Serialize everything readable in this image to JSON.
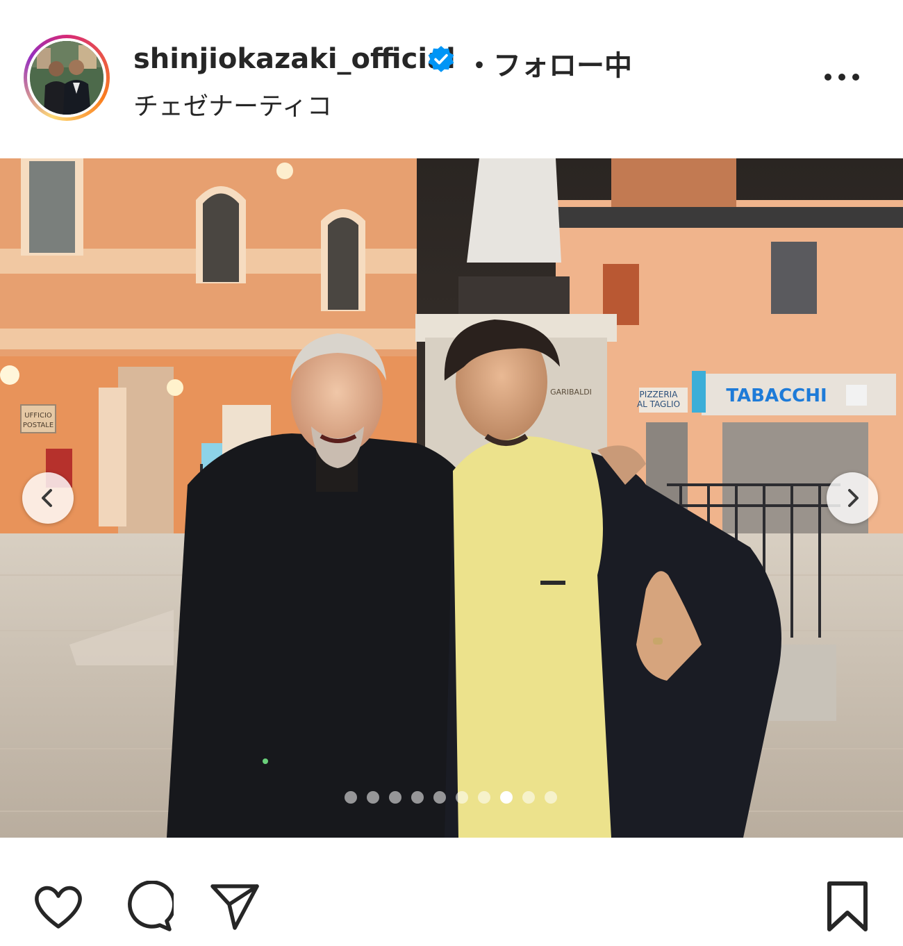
{
  "header": {
    "username": "shinjiokazaki_official",
    "separator": "・",
    "follow_status": "フォロー中",
    "location": "チェゼナーティコ",
    "verified_icon": "verified-badge-icon",
    "more_icon": "more-options-icon"
  },
  "photo": {
    "signs": {
      "tabacchi": "TABACCHI",
      "pizzeria_line1": "PIZZERIA",
      "pizzeria_line2": "AL TAGLIO",
      "garibaldi": "GARIBALDI",
      "post_line1": "UFFICIO",
      "post_line2": "POSTALE"
    },
    "carousel": {
      "total": 10,
      "active_index": 7
    },
    "prev_icon": "chevron-left-icon",
    "next_icon": "chevron-right-icon"
  },
  "actions": {
    "like_icon": "heart-icon",
    "comment_icon": "comment-icon",
    "share_icon": "send-icon",
    "save_icon": "bookmark-icon"
  },
  "colors": {
    "verified": "#0095f6",
    "text": "#262626",
    "sign_blue": "#1e7bd8"
  }
}
